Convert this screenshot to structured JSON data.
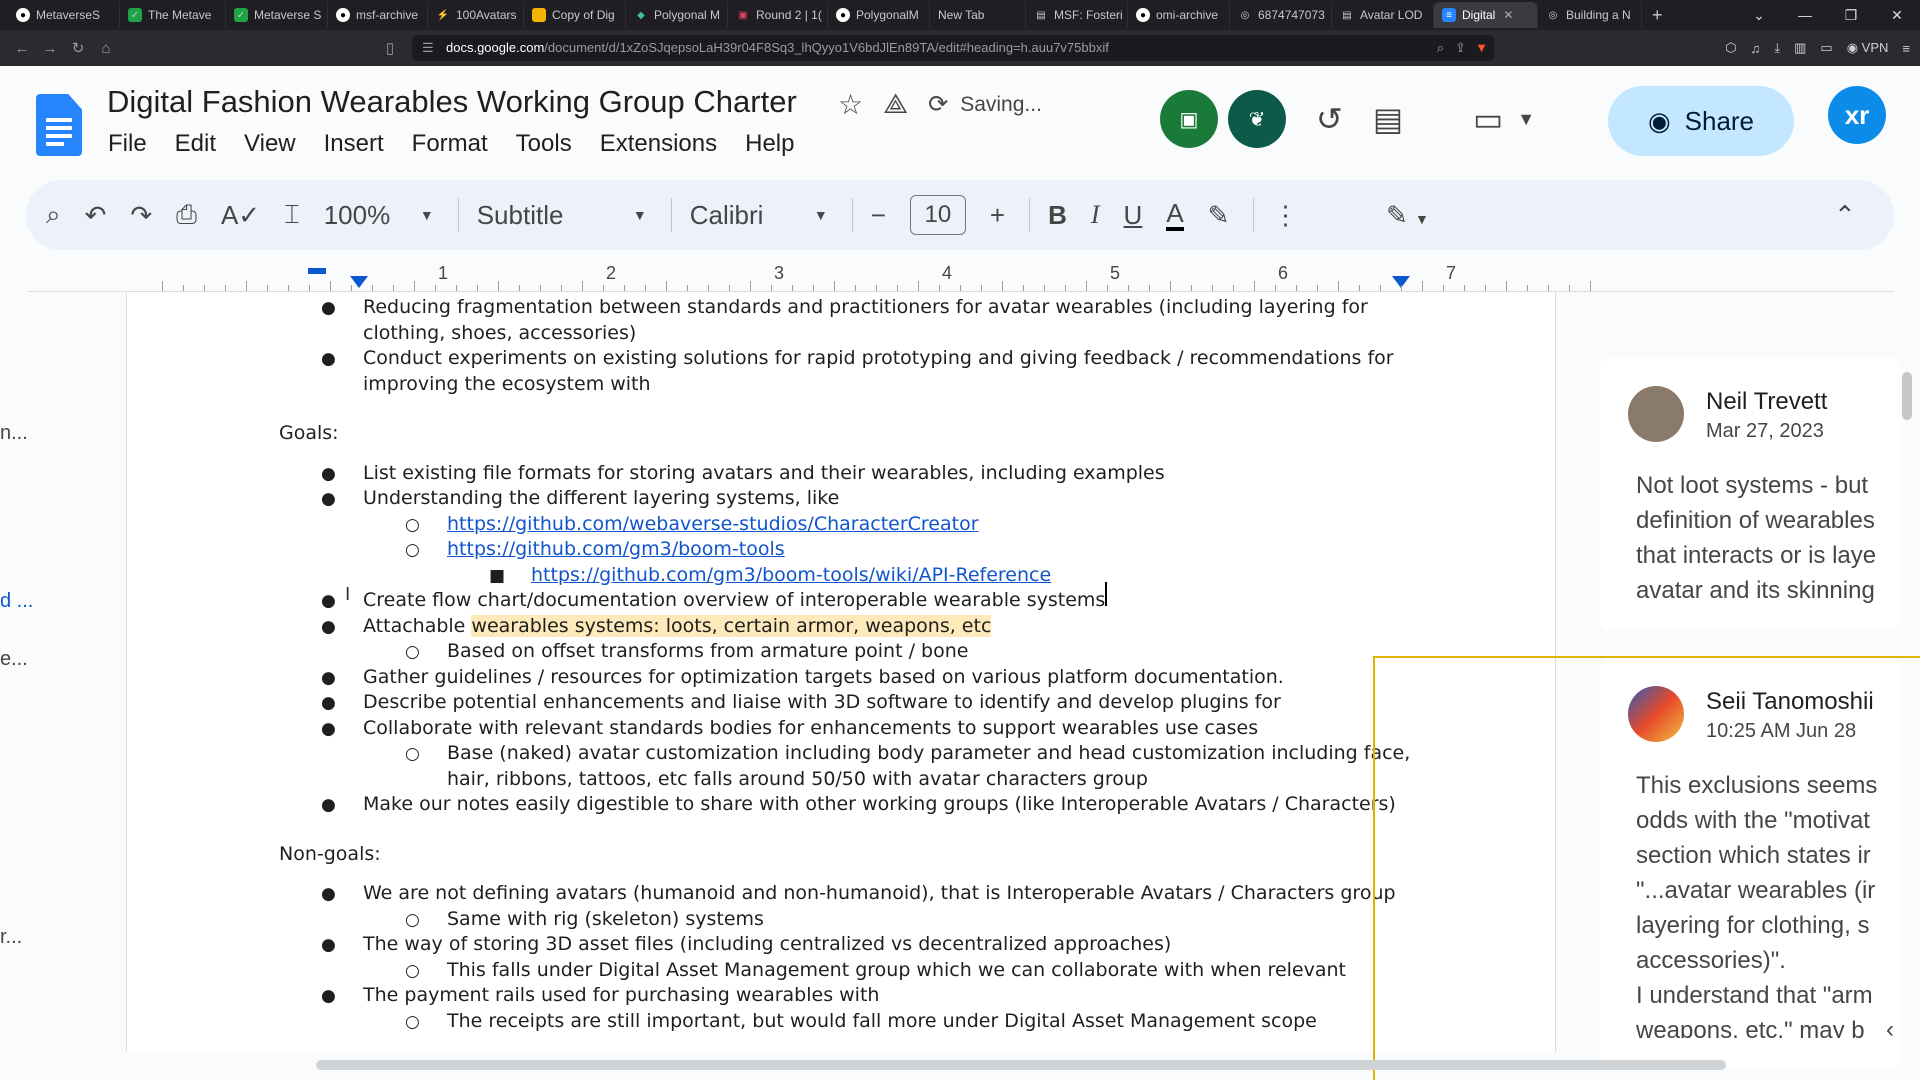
{
  "browser": {
    "tabs": [
      {
        "label": "MetaverseS"
      },
      {
        "label": "The Metave"
      },
      {
        "label": "Metaverse S"
      },
      {
        "label": "msf-archive"
      },
      {
        "label": "100Avatars"
      },
      {
        "label": "Copy of Dig"
      },
      {
        "label": "Polygonal M"
      },
      {
        "label": "Round 2 | 1("
      },
      {
        "label": "PolygonalM"
      },
      {
        "label": "New Tab"
      },
      {
        "label": "MSF: Fosteri"
      },
      {
        "label": "omi-archive"
      },
      {
        "label": "6874747073"
      },
      {
        "label": "Avatar LOD"
      },
      {
        "label": "Digital"
      },
      {
        "label": "Building a N"
      }
    ],
    "url_host": "docs.google.com",
    "url_path": "/document/d/1xZoSJqepsoLaH39r04F8Sq3_lhQyyo1V6bdJlEn89TA/edit#heading=h.auu7v75bbxif",
    "vpn_label": "VPN"
  },
  "doc": {
    "title": "Digital Fashion Wearables Working Group Charter",
    "save_status": "Saving...",
    "menu": [
      "File",
      "Edit",
      "View",
      "Insert",
      "Format",
      "Tools",
      "Extensions",
      "Help"
    ],
    "share_label": "Share",
    "user_initials": "xr"
  },
  "toolbar": {
    "zoom": "100%",
    "style": "Subtitle",
    "font": "Calibri",
    "font_size": "10"
  },
  "ruler": {
    "numbers": [
      "1",
      "2",
      "3",
      "4",
      "5",
      "6",
      "7"
    ]
  },
  "content": {
    "lines": [
      {
        "text": "Reducing fragmentation between standards and practitioners for avatar wearables (including layering for",
        "level": 1,
        "bullet": true
      },
      {
        "text": "clothing, shoes, accessories)",
        "level": 1,
        "bullet": false
      },
      {
        "text": "Conduct experiments on existing solutions for rapid prototyping and giving feedback / recommendations for",
        "level": 1,
        "bullet": true
      },
      {
        "text": "improving the ecosystem with",
        "level": 1,
        "bullet": false
      },
      {
        "text": "Goals:",
        "level": 0,
        "bullet": false
      },
      {
        "text": "List existing file formats for storing avatars and their wearables, including examples",
        "level": 1,
        "bullet": true
      },
      {
        "text": "Understanding the different layering systems, like",
        "level": 1,
        "bullet": true
      },
      {
        "text": "https://github.com/webaverse-studios/CharacterCreator",
        "level": 2,
        "bullet": true,
        "link": true
      },
      {
        "text": "https://github.com/gm3/boom-tools",
        "level": 2,
        "bullet": true,
        "link": true
      },
      {
        "text": "https://github.com/gm3/boom-tools/wiki/API-Reference",
        "level": 3,
        "bullet": true,
        "link": true
      },
      {
        "text": "Create flow chart/documentation overview of interoperable wearable systems",
        "level": 1,
        "bullet": true
      },
      {
        "text_a": "Attachable ",
        "text_b": "wearables systems: loots, certain armor, weapons, etc",
        "level": 1,
        "bullet": true
      },
      {
        "text": "Based on offset transforms from armature point / bone",
        "level": 2,
        "bullet": true
      },
      {
        "text": "Gather guidelines / resources for optimization targets based on various platform documentation.",
        "level": 1,
        "bullet": true
      },
      {
        "text": "Describe potential enhancements and liaise with 3D software to identify and develop plugins for",
        "level": 1,
        "bullet": true
      },
      {
        "text": "Collaborate with relevant standards bodies for enhancements to support wearables use cases",
        "level": 1,
        "bullet": true
      },
      {
        "text": "Base (naked) avatar customization including body parameter and head customization including face,",
        "level": 2,
        "bullet": true
      },
      {
        "text": "hair, ribbons, tattoos, etc falls around 50/50 with avatar characters group",
        "level": 2,
        "bullet": false
      },
      {
        "text": "Make our notes easily digestible to share with other working groups (like Interoperable Avatars / Characters)",
        "level": 1,
        "bullet": true
      },
      {
        "text": "Non-goals:",
        "level": 0,
        "bullet": false
      },
      {
        "text": "We are not defining avatars (humanoid and non-humanoid), that is Interoperable Avatars / Characters group",
        "level": 1,
        "bullet": true
      },
      {
        "text": "Same with rig (skeleton) systems",
        "level": 2,
        "bullet": true
      },
      {
        "text": "The way of storing 3D asset files (including centralized vs decentralized approaches)",
        "level": 1,
        "bullet": true
      },
      {
        "text": "This falls under Digital Asset Management group which we can collaborate with when relevant",
        "level": 2,
        "bullet": true
      },
      {
        "text": "The payment rails used for purchasing wearables with",
        "level": 1,
        "bullet": true
      },
      {
        "text": "The receipts are still important, but would fall more under Digital Asset Management scope",
        "level": 2,
        "bullet": true
      }
    ]
  },
  "comments": [
    {
      "author": "Neil Trevett",
      "date": "Mar 27, 2023",
      "text": "Not loot systems - but\ndefinition of wearables\nthat interacts or is laye\navatar and its skinning"
    },
    {
      "author": "Seii Tanomoshii",
      "date": "10:25 AM Jun 28",
      "text": "This exclusions seems\nodds with the \"motivat\nsection which states ir\n\"...avatar wearables (ir\nlayering for clothing, s\naccessories)\".\nI understand that \"arm\nweapons, etc.\" may b"
    }
  ],
  "left_panel": {
    "snippets": [
      "n...",
      "d ...",
      "e...",
      "r..."
    ]
  },
  "colors": {
    "accent": "#0b57d0",
    "share_bg": "#c2e7ff",
    "highlight": "#fde9b9",
    "link": "#1155cc",
    "selection_border": "#e0b400"
  }
}
